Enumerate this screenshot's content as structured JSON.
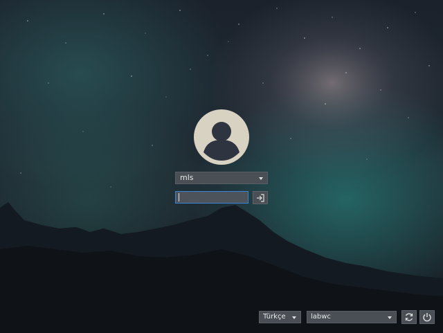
{
  "login": {
    "user_select_value": "mls",
    "password_value": ""
  },
  "icons": {
    "avatar": "user-avatar-icon",
    "login": "login-arrow-icon",
    "restart": "restart-icon",
    "power": "power-icon",
    "dropdown": "chevron-down-icon"
  },
  "bottom_bar": {
    "language_value": "Türkçe",
    "session_value": "labwc"
  },
  "colors": {
    "accent_focus": "#3d84d6",
    "avatar_bg": "#d8d2c2",
    "avatar_fg": "#2e3440"
  }
}
